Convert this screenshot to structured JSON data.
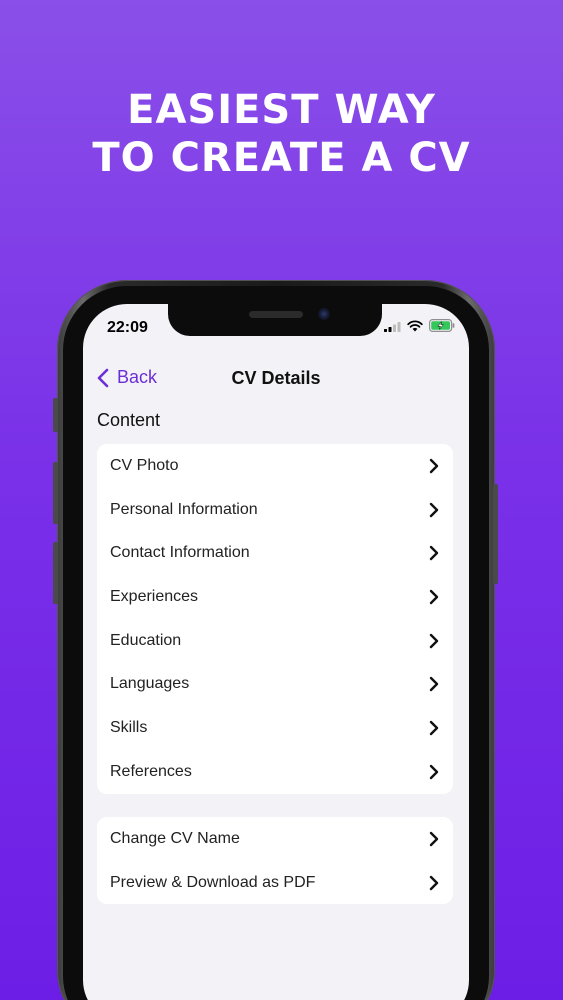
{
  "headline": {
    "line1": "EASIEST WAY",
    "line2": "TO CREATE A CV"
  },
  "status_bar": {
    "time": "22:09",
    "icons": [
      "cellular-signal-icon",
      "wifi-icon",
      "battery-charging-icon"
    ]
  },
  "nav": {
    "back_label": "Back",
    "title": "CV Details"
  },
  "content": {
    "section_title": "Content",
    "items": [
      {
        "label": "CV Photo"
      },
      {
        "label": "Personal Information"
      },
      {
        "label": "Contact Information"
      },
      {
        "label": "Experiences"
      },
      {
        "label": "Education"
      },
      {
        "label": "Languages"
      },
      {
        "label": "Skills"
      },
      {
        "label": "References"
      }
    ]
  },
  "actions": {
    "items": [
      {
        "label": "Change CV Name"
      },
      {
        "label": "Preview & Download as PDF"
      }
    ]
  },
  "colors": {
    "accent": "#6c2fd6",
    "background_top": "#8a4fe8",
    "background_bottom": "#6d1ee6",
    "screen_bg": "#f2f2f7",
    "battery": "#34c759"
  }
}
